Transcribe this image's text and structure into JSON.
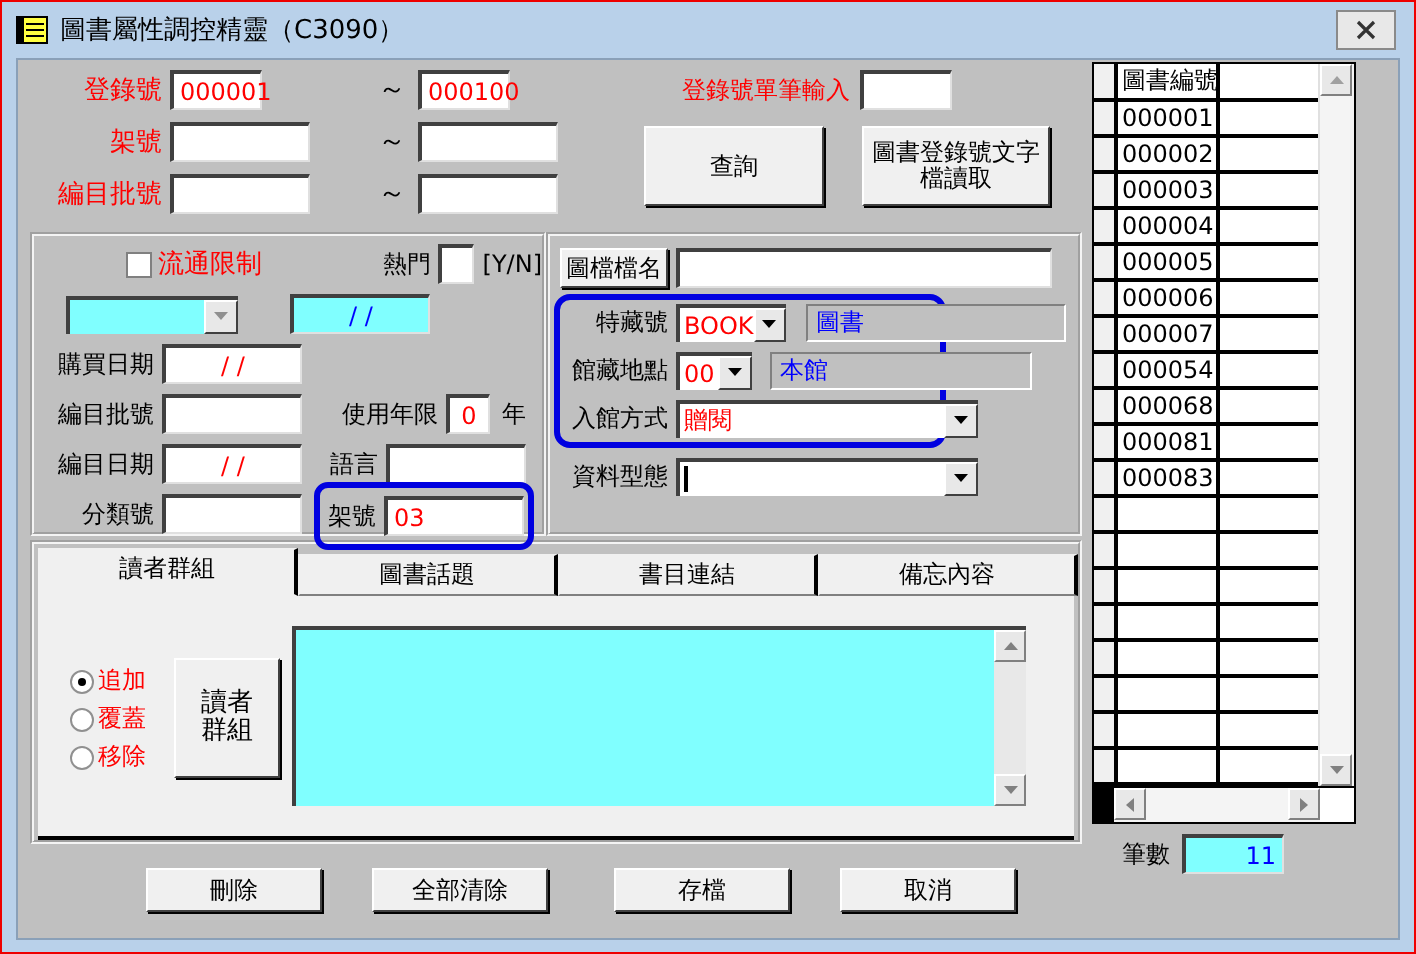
{
  "window": {
    "title": "圖書屬性調控精靈（C3090）"
  },
  "range_rows": [
    {
      "label": "登錄號",
      "from": "000001",
      "separator": "～",
      "to": "000100"
    },
    {
      "label": "架號",
      "separator": "～"
    },
    {
      "label": "編目批號",
      "separator": "～"
    }
  ],
  "single_entry": {
    "label": "登錄號單筆輸入"
  },
  "action_buttons": [
    "查詢",
    "圖書登錄號文字檔讀取"
  ],
  "attributes": {
    "circulation_limit": {
      "label": "流通限制",
      "checked": false
    },
    "popular": {
      "label": "熱門",
      "hint": "[Y/N]"
    },
    "date_field": {
      "value": "/ /"
    },
    "purchase_date": {
      "label": "購買日期",
      "value": "/ /"
    },
    "batch_no": {
      "label": "編目批號"
    },
    "years": {
      "label": "使用年限",
      "value": "0",
      "unit": "年"
    },
    "catalog_date": {
      "label": "編目日期",
      "value": "/ /"
    },
    "language": {
      "label": "語言"
    },
    "class_no": {
      "label": "分類號"
    },
    "shelf": {
      "label": "架號",
      "value": "03",
      "highlighted": true
    }
  },
  "details": {
    "image_button": "圖檔檔名",
    "rows": [
      {
        "label": "特藏號",
        "value": "BOOK",
        "description": "圖書",
        "highlighted": true,
        "focused": false
      },
      {
        "label": "館藏地點",
        "value": "00",
        "description": "本館",
        "highlighted": true,
        "focused": false
      },
      {
        "label": "入館方式",
        "value": "贈閱",
        "highlighted": true,
        "focused": false
      },
      {
        "label": "資料型態",
        "highlighted": false,
        "focused": true
      }
    ]
  },
  "tabs": [
    {
      "label": "讀者群組",
      "selected": true
    },
    {
      "label": "圖書話題",
      "selected": false
    },
    {
      "label": "書目連結",
      "selected": false
    },
    {
      "label": "備忘內容",
      "selected": false
    }
  ],
  "group_options": [
    {
      "label": "追加",
      "selected": true
    },
    {
      "label": "覆蓋",
      "selected": false
    },
    {
      "label": "移除",
      "selected": false
    }
  ],
  "group_button": "讀者群組",
  "bottom_buttons": [
    "刪除",
    "全部清除",
    "存檔",
    "取消"
  ],
  "table": {
    "columns": [
      {
        "label": "圖書編號"
      }
    ],
    "rows": [
      "000001",
      "000002",
      "000003",
      "000004",
      "000005",
      "000006",
      "000007",
      "000054",
      "000068",
      "000081",
      "000083"
    ]
  },
  "count": {
    "label": "筆數",
    "value": "11"
  }
}
